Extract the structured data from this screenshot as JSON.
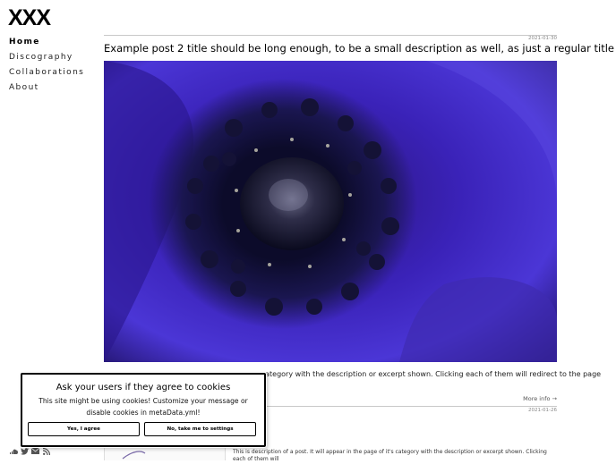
{
  "site": {
    "logo": "XXX"
  },
  "nav": {
    "items": [
      {
        "label": "Home",
        "active": true
      },
      {
        "label": "Discography",
        "active": false
      },
      {
        "label": "Collaborations",
        "active": false
      },
      {
        "label": "About",
        "active": false
      }
    ]
  },
  "posts": [
    {
      "date": "2021-01-30",
      "title": "Example post 2 title should be long enough, to be a small description as well, as just a regular title",
      "image_subject": "purple anemone flower close-up",
      "excerpt": "s category with the description or excerpt shown. Clicking each of them will redirect to the page",
      "more_label": "More info →"
    },
    {
      "date": "2021-01-26",
      "excerpt": "This is description of a post. It will appear in the page of it's category with the description or excerpt shown. Clicking each of them will"
    }
  ],
  "cookie_banner": {
    "title": "Ask your users if they agree to cookies",
    "message": "This site might be using cookies! Customize your message or disable cookies in metaData.yml!",
    "agree_label": "Yes, I agree",
    "settings_label": "No, take me to settings"
  },
  "social": {
    "icons": [
      "soundcloud-icon",
      "twitter-icon",
      "email-icon",
      "rss-icon"
    ]
  },
  "colors": {
    "petal": "#4a2bd0",
    "petal_dark": "#1b0f4a",
    "center": "#0c0b2a",
    "text": "#111111"
  }
}
